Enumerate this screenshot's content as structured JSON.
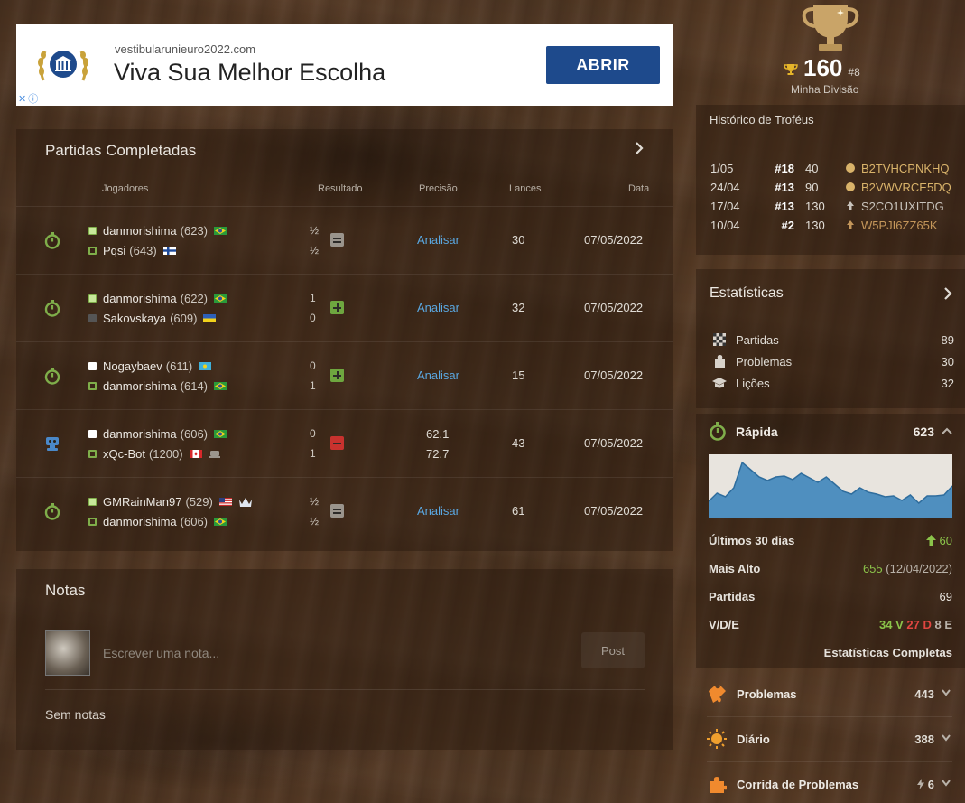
{
  "ad": {
    "domain": "vestibularunieuro2022.com",
    "headline": "Viva Sua Melhor Escolha",
    "button": "ABRIR",
    "close_label": "✕",
    "info_label": "ⓘ"
  },
  "games": {
    "title": "Partidas Completadas",
    "columns": {
      "players": "Jogadores",
      "result": "Resultado",
      "accuracy": "Precisão",
      "moves": "Lances",
      "date": "Data"
    },
    "rows": [
      {
        "type": "rapid",
        "white": {
          "name": "danmorishima",
          "rating": "(623)"
        },
        "black": {
          "name": "Pqsi",
          "rating": "(643)"
        },
        "r1": "½",
        "r2": "½",
        "outcome": "draw",
        "analyze": "Analisar",
        "moves": "30",
        "date": "07/05/2022"
      },
      {
        "type": "rapid",
        "white": {
          "name": "danmorishima",
          "rating": "(622)"
        },
        "black": {
          "name": "Sakovskaya",
          "rating": "(609)"
        },
        "r1": "1",
        "r2": "0",
        "outcome": "win",
        "analyze": "Analisar",
        "moves": "32",
        "date": "07/05/2022"
      },
      {
        "type": "rapid",
        "white": {
          "name": "Nogaybaev",
          "rating": "(611)"
        },
        "black": {
          "name": "danmorishima",
          "rating": "(614)"
        },
        "r1": "0",
        "r2": "1",
        "outcome": "win",
        "analyze": "Analisar",
        "moves": "15",
        "date": "07/05/2022"
      },
      {
        "type": "computer",
        "white": {
          "name": "danmorishima",
          "rating": "(606)"
        },
        "black": {
          "name": "xQc-Bot",
          "rating": "(1200)"
        },
        "r1": "0",
        "r2": "1",
        "outcome": "loss",
        "acc1": "62.1",
        "acc2": "72.7",
        "moves": "43",
        "date": "07/05/2022"
      },
      {
        "type": "rapid",
        "white": {
          "name": "GMRainMan97",
          "rating": "(529)"
        },
        "black": {
          "name": "danmorishima",
          "rating": "(606)"
        },
        "r1": "½",
        "r2": "½",
        "outcome": "draw",
        "analyze": "Analisar",
        "moves": "61",
        "date": "07/05/2022"
      }
    ]
  },
  "notes": {
    "title": "Notas",
    "placeholder": "Escrever uma nota...",
    "post": "Post",
    "empty": "Sem notas"
  },
  "division": {
    "score": "160",
    "rank": "#8",
    "label": "Minha Divisão"
  },
  "trophies": {
    "title": "Histórico de Troféus",
    "rows": [
      {
        "date": "1/05",
        "rank": "#18",
        "points": "40",
        "code": "B2TVHCPNKHQ",
        "color": "#d9b36a"
      },
      {
        "date": "24/04",
        "rank": "#13",
        "points": "90",
        "code": "B2VWVRCE5DQ",
        "color": "#d9b36a"
      },
      {
        "date": "17/04",
        "rank": "#13",
        "points": "130",
        "code": "S2CO1UXITDG",
        "color": "#c9c4bd"
      },
      {
        "date": "10/04",
        "rank": "#2",
        "points": "130",
        "code": "W5PJI6ZZ65K",
        "color": "#c4965a"
      }
    ]
  },
  "stats": {
    "title": "Estatísticas",
    "items": [
      {
        "label": "Partidas",
        "value": "89"
      },
      {
        "label": "Problemas",
        "value": "30"
      },
      {
        "label": "Lições",
        "value": "32"
      }
    ]
  },
  "rapid": {
    "label": "Rápida",
    "value": "623",
    "last30_label": "Últimos 30 dias",
    "last30_value": "60",
    "highest_label": "Mais Alto",
    "highest_value": "655",
    "highest_date": "(12/04/2022)",
    "games_label": "Partidas",
    "games_value": "69",
    "wdl_label": "V/D/E",
    "wins": "34 V",
    "losses": "27 D",
    "draws": "8 E",
    "full_stats": "Estatísticas Completas",
    "chart_data": {
      "type": "area",
      "values": [
        563,
        572,
        568,
        578,
        606,
        598,
        590,
        586,
        590,
        591,
        587,
        594,
        589,
        584,
        590,
        582,
        574,
        571,
        578,
        573,
        571,
        568,
        569,
        564,
        570,
        561,
        569,
        569,
        570,
        580
      ]
    }
  },
  "modes": [
    {
      "label": "Problemas",
      "value": "443"
    },
    {
      "label": "Diário",
      "value": "388"
    },
    {
      "label": "Corrida de Problemas",
      "value": "6"
    }
  ]
}
